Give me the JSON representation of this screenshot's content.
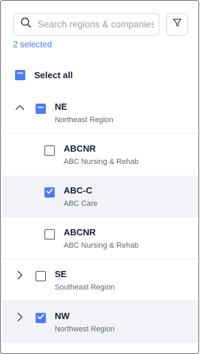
{
  "search": {
    "placeholder": "Search regions & companies",
    "value": ""
  },
  "selected_label": "2 selected",
  "select_all": {
    "label": "Select all",
    "state": "mixed"
  },
  "regions": [
    {
      "code": "NE",
      "name": "Northeast Region",
      "expanded": true,
      "state": "mixed",
      "companies": [
        {
          "code": "ABCNR",
          "name": "ABC Nursing & Rehab",
          "checked": false
        },
        {
          "code": "ABC-C",
          "name": "ABC Care",
          "checked": true
        },
        {
          "code": "ABCNR",
          "name": "ABC Nursing & Rehab",
          "checked": false
        }
      ]
    },
    {
      "code": "SE",
      "name": "Southeast Region",
      "expanded": false,
      "state": "unchecked"
    },
    {
      "code": "NW",
      "name": "Northwest Region",
      "expanded": false,
      "state": "checked"
    }
  ],
  "colors": {
    "accent": "#4e7cf0",
    "link": "#4a7bf0",
    "row_highlight": "#f2f3f7"
  }
}
